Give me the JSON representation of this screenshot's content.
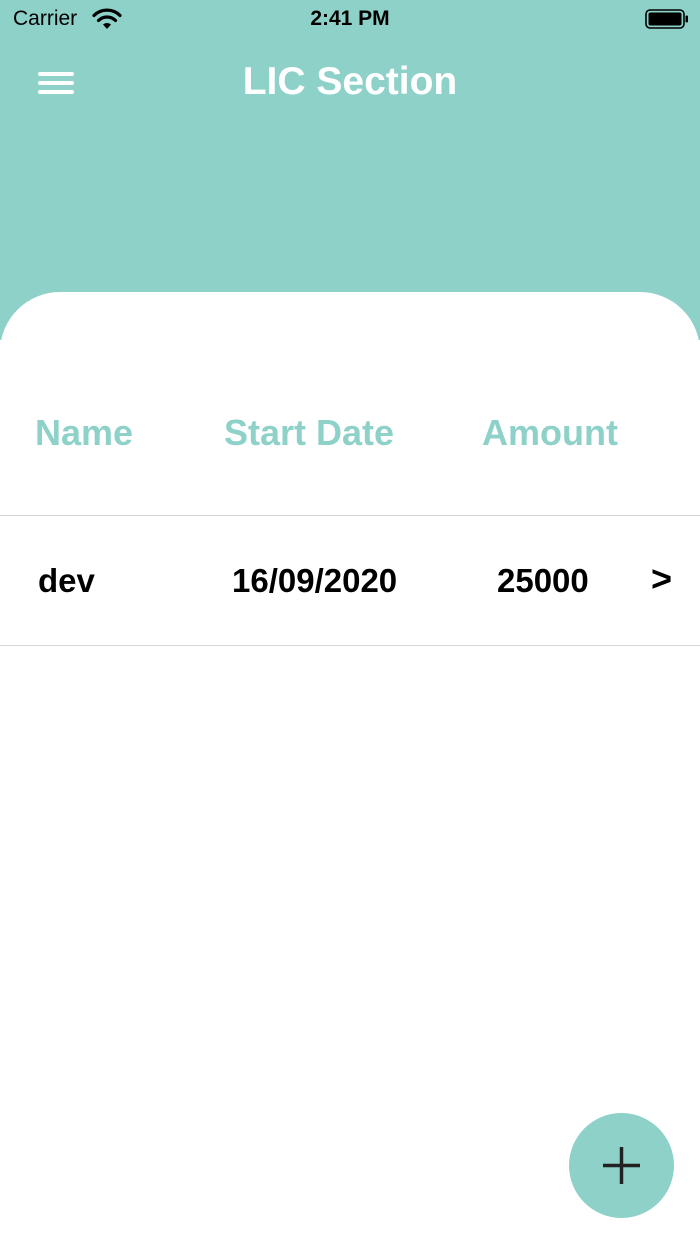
{
  "status_bar": {
    "carrier": "Carrier",
    "time": "2:41 PM",
    "wifi_icon": "wifi-icon",
    "battery_icon": "battery-icon"
  },
  "header": {
    "title": "LIC Section",
    "menu_icon": "hamburger-menu-icon",
    "background_color": "#8dd1c8"
  },
  "table": {
    "columns": [
      "Name",
      "Start Date",
      "Amount"
    ],
    "rows": [
      {
        "name": "dev",
        "start_date": "16/09/2020",
        "amount": "25000",
        "chevron": ">"
      }
    ]
  },
  "fab": {
    "icon": "plus-icon",
    "color": "#8dd1c8"
  }
}
